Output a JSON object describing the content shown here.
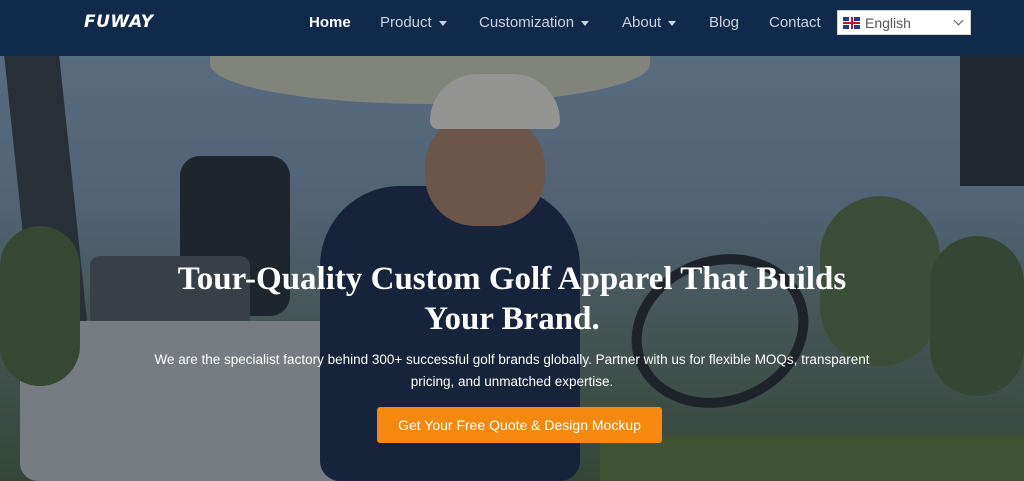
{
  "header": {
    "logo": "FUWAY",
    "nav": [
      {
        "label": "Home"
      },
      {
        "label": "Product"
      },
      {
        "label": "Customization"
      },
      {
        "label": "About"
      },
      {
        "label": "Blog"
      },
      {
        "label": "Contact"
      }
    ],
    "language": {
      "selected": "English",
      "flag_icon": "uk-flag-icon"
    }
  },
  "hero": {
    "title": "Tour-Quality Custom Golf Apparel That Builds Your Brand.",
    "subtitle": "We are the specialist factory behind 300+ successful golf brands globally. Partner with us for flexible MOQs, transparent pricing, and unmatched expertise.",
    "cta_label": "Get Your Free Quote & Design Mockup"
  },
  "colors": {
    "header_bg": "#102a4c",
    "cta_bg": "#f5890f",
    "text_light": "#ffffff"
  }
}
